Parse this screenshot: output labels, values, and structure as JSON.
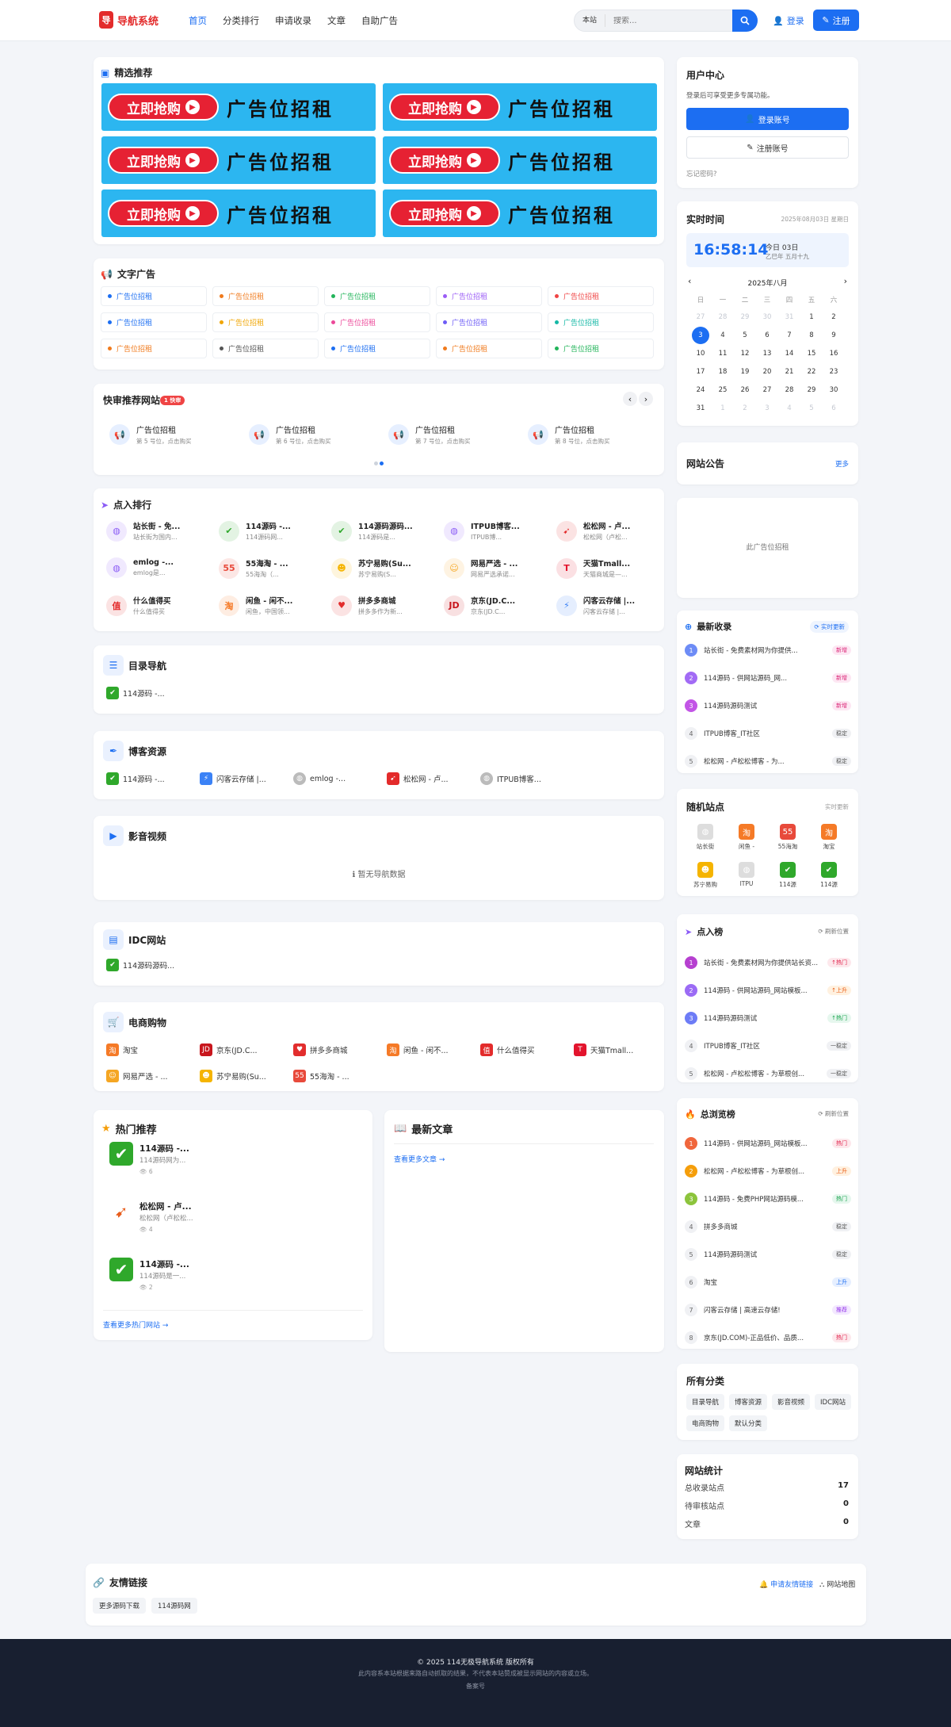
{
  "header": {
    "logo_icon": "导",
    "logo": "导航系统",
    "nav": [
      "首页",
      "分类排行",
      "申请收录",
      "文章",
      "自助广告"
    ],
    "search_scope": "本站",
    "search_placeholder": "搜索...",
    "login": "登录",
    "register": "注册"
  },
  "featured": {
    "title": "精选推荐",
    "banner_btn": "立即抢购",
    "banner_text": "广告位招租",
    "banner_count": 6
  },
  "text_ads": {
    "title": "文字广告",
    "label": "广告位招租",
    "colors": [
      "#1c6ef2",
      "#f07a1c",
      "#22b45a",
      "#9b5cf6",
      "#ef4444",
      "#1c6ef2",
      "#f0a500",
      "#ec4899",
      "#6d5cf6",
      "#14b8a6",
      "#f07a1c",
      "#555555",
      "#1c6ef2",
      "#f07a1c",
      "#22b45a"
    ]
  },
  "quick": {
    "title": "快审推荐网站",
    "badge": "1 快审",
    "items": [
      {
        "name": "广告位招租",
        "desc": "第 5 号位，点击购买"
      },
      {
        "name": "广告位招租",
        "desc": "第 6 号位，点击购买"
      },
      {
        "name": "广告位招租",
        "desc": "第 7 号位，点击购买"
      },
      {
        "name": "广告位招租",
        "desc": "第 8 号位，点击购买"
      }
    ]
  },
  "clicks": {
    "title": "点入排行",
    "items": [
      {
        "name": "站长街 - 免...",
        "desc": "站长街为国内...",
        "icon": "#8b5cf6",
        "glyph": "◍"
      },
      {
        "name": "114源码 -...",
        "desc": "114源码网...",
        "icon": "#2fa82b",
        "glyph": "✔"
      },
      {
        "name": "114源码源码...",
        "desc": "114源码是...",
        "icon": "#2fa82b",
        "glyph": "✔"
      },
      {
        "name": "ITPUB博客...",
        "desc": "ITPUB博...",
        "icon": "#8b5cf6",
        "glyph": "◍"
      },
      {
        "name": "松松网 - 卢...",
        "desc": "松松网（卢松...",
        "icon": "#e32b2b",
        "glyph": "➹"
      },
      {
        "name": "emlog -...",
        "desc": "emlog是...",
        "icon": "#8b5cf6",
        "glyph": "◍"
      },
      {
        "name": "55海淘 - ...",
        "desc": "55海淘（...",
        "icon": "#e84a3b",
        "glyph": "55"
      },
      {
        "name": "苏宁易购(Su...",
        "desc": "苏宁易购(S...",
        "icon": "#f5b400",
        "glyph": "☻"
      },
      {
        "name": "网易严选 - ...",
        "desc": "网易严选承诺...",
        "icon": "#f5a623",
        "glyph": "☺"
      },
      {
        "name": "天猫Tmall...",
        "desc": "天猫商城是—...",
        "icon": "#e3142d",
        "glyph": "T"
      },
      {
        "name": "什么值得买",
        "desc": "什么值得买",
        "icon": "#e32b2b",
        "glyph": "值"
      },
      {
        "name": "闲鱼 - 闲不...",
        "desc": "闲鱼，中国领...",
        "icon": "#f57a27",
        "glyph": "淘"
      },
      {
        "name": "拼多多商城",
        "desc": "拼多多作为新...",
        "icon": "#e22d2d",
        "glyph": "♥"
      },
      {
        "name": "京东(JD.C...",
        "desc": "京东(JD.C...",
        "icon": "#c8161d",
        "glyph": "JD"
      },
      {
        "name": "闪客云存储 |...",
        "desc": "闪客云存储 |...",
        "icon": "#3b82f6",
        "glyph": "⚡"
      }
    ]
  },
  "cat_dir": {
    "title": "目录导航",
    "items": [
      {
        "name": "114源码 -...",
        "c": "#2fa82b",
        "g": "✔"
      }
    ]
  },
  "cat_blog": {
    "title": "博客资源",
    "items": [
      {
        "name": "114源码 -...",
        "c": "#2fa82b",
        "g": "✔"
      },
      {
        "name": "闪客云存储 |...",
        "c": "#3b82f6",
        "g": "⚡"
      },
      {
        "name": "emlog -...",
        "c": "#bbbbbb",
        "g": "◍"
      },
      {
        "name": "松松网 - 卢...",
        "c": "#e32b2b",
        "g": "➹"
      },
      {
        "name": "ITPUB博客...",
        "c": "#bbbbbb",
        "g": "◍"
      }
    ]
  },
  "cat_video": {
    "title": "影音视频",
    "empty": "暂无导航数据"
  },
  "cat_idc": {
    "title": "IDC网站",
    "items": [
      {
        "name": "114源码源码...",
        "c": "#2fa82b",
        "g": "✔"
      }
    ]
  },
  "cat_shop": {
    "title": "电商购物",
    "items": [
      {
        "name": "淘宝",
        "c": "#f57a27",
        "g": "淘"
      },
      {
        "name": "京东(JD.C...",
        "c": "#c8161d",
        "g": "JD"
      },
      {
        "name": "拼多多商城",
        "c": "#e22d2d",
        "g": "♥"
      },
      {
        "name": "闲鱼 - 闲不...",
        "c": "#f57a27",
        "g": "淘"
      },
      {
        "name": "什么值得买",
        "c": "#e32b2b",
        "g": "值"
      },
      {
        "name": "天猫Tmall...",
        "c": "#e3142d",
        "g": "T"
      },
      {
        "name": "网易严选 - ...",
        "c": "#f5a623",
        "g": "☺"
      },
      {
        "name": "苏宁易购(Su...",
        "c": "#f5b400",
        "g": "☻"
      },
      {
        "name": "55海淘 - ...",
        "c": "#e84a3b",
        "g": "55"
      }
    ]
  },
  "hot": {
    "title": "热门推荐",
    "items": [
      {
        "name": "114源码 -...",
        "desc": "114源码网为...",
        "views": "6",
        "c": "#2fa82b",
        "g": "✔"
      },
      {
        "name": "松松网 - 卢...",
        "desc": "松松网（卢松松...",
        "views": "4",
        "c": "#ffffff",
        "g": "➹"
      },
      {
        "name": "114源码 -...",
        "desc": "114源码是一...",
        "views": "2",
        "c": "#2fa82b",
        "g": "✔"
      }
    ],
    "more": "查看更多热门网站 →"
  },
  "articles": {
    "title": "最新文章",
    "more": "查看更多文章 →"
  },
  "user": {
    "title": "用户中心",
    "desc": "登录后可享受更多专属功能。",
    "login": "登录账号",
    "register": "注册账号",
    "forgot": "忘记密码?"
  },
  "clock": {
    "title": "实时时间",
    "date": "2025年08月03日 星期日",
    "time": "16:58:14",
    "today": "今日 03日",
    "lunar": "乙巳年 五月十九",
    "month": "2025年八月",
    "weekdays": [
      "日",
      "一",
      "二",
      "三",
      "四",
      "五",
      "六"
    ],
    "days": [
      [
        "27",
        "28",
        "29",
        "30",
        "31",
        "1",
        "2"
      ],
      [
        "3",
        "4",
        "5",
        "6",
        "7",
        "8",
        "9"
      ],
      [
        "10",
        "11",
        "12",
        "13",
        "14",
        "15",
        "16"
      ],
      [
        "17",
        "18",
        "19",
        "20",
        "21",
        "22",
        "23"
      ],
      [
        "24",
        "25",
        "26",
        "27",
        "28",
        "29",
        "30"
      ],
      [
        "31",
        "1",
        "2",
        "3",
        "4",
        "5",
        "6"
      ]
    ]
  },
  "notice": {
    "title": "网站公告",
    "more": "更多"
  },
  "ad_slot": "此广告位招租",
  "latest": {
    "title": "最新收录",
    "refresh": "实时更新",
    "items": [
      {
        "t": "站长街 - 免费素材网为你提供...",
        "tag": "新增"
      },
      {
        "t": "114源码 - 供网站源码_网...",
        "tag": "新增"
      },
      {
        "t": "114源码源码测试",
        "tag": "新增"
      },
      {
        "t": "ITPUB博客_IT社区",
        "tag": "稳定"
      },
      {
        "t": "松松网 - 卢松松博客 - 为...",
        "tag": "稳定"
      }
    ]
  },
  "random": {
    "title": "随机站点",
    "refresh": "实时更新",
    "items": [
      {
        "n": "站长街",
        "c": "#dddddd",
        "g": "◍"
      },
      {
        "n": "闲鱼 -",
        "c": "#f57a27",
        "g": "淘"
      },
      {
        "n": "55海淘",
        "c": "#e84a3b",
        "g": "55"
      },
      {
        "n": "淘宝",
        "c": "#f57a27",
        "g": "淘"
      },
      {
        "n": "苏宁易购",
        "c": "#f5b400",
        "g": "☻"
      },
      {
        "n": "ITPU",
        "c": "#dddddd",
        "g": "◍"
      },
      {
        "n": "114源",
        "c": "#2fa82b",
        "g": "✔"
      },
      {
        "n": "114源",
        "c": "#2fa82b",
        "g": "✔"
      }
    ]
  },
  "clickrank": {
    "title": "点入榜",
    "refresh": "刷新位置",
    "items": [
      {
        "t": "站长街 - 免费素材网为你提供站长资...",
        "tag": "↑热门"
      },
      {
        "t": "114源码 - 供网站源码_网站模板...",
        "tag": "↑上升"
      },
      {
        "t": "114源码源码测试",
        "tag": "↑热门"
      },
      {
        "t": "ITPUB博客_IT社区",
        "tag": "一稳定"
      },
      {
        "t": "松松网 - 卢松松博客 - 为草根创...",
        "tag": "一稳定"
      }
    ]
  },
  "viewrank": {
    "title": "总浏览榜",
    "refresh": "刷新位置",
    "items": [
      {
        "t": "114源码 - 供网站源码_网站模板...",
        "tag": "热门"
      },
      {
        "t": "松松网 - 卢松松博客 - 为草根创...",
        "tag": "上升"
      },
      {
        "t": "114源码 - 免费PHP网站源码模...",
        "tag": "热门"
      },
      {
        "t": "拼多多商城",
        "tag": "稳定"
      },
      {
        "t": "114源码源码测试",
        "tag": "稳定"
      },
      {
        "t": "淘宝",
        "tag": "上升"
      },
      {
        "t": "闪客云存储 | 高速云存储!",
        "tag": "推荐"
      },
      {
        "t": "京东(JD.COM)-正品低价、品质...",
        "tag": "热门"
      }
    ]
  },
  "categories": {
    "title": "所有分类",
    "items": [
      "目录导航",
      "博客资源",
      "影音视频",
      "IDC网站",
      "电商购物",
      "默认分类"
    ]
  },
  "stats": {
    "title": "网站统计",
    "rows": [
      {
        "k": "总收录站点",
        "v": "17"
      },
      {
        "k": "待审核站点",
        "v": "0"
      },
      {
        "k": "文章",
        "v": "0"
      }
    ]
  },
  "links": {
    "title": "友情链接",
    "apply": "申请友情链接",
    "sitemap": "网站地图",
    "items": [
      "更多源码下载",
      "114源码网"
    ]
  },
  "footer": {
    "copyright": "© 2025 114无极导航系统 版权所有",
    "disclaimer": "此内容系本站根据来路自动抓取的结果，不代表本站赞成被显示网站的内容或立场。",
    "icp": "备案号"
  }
}
